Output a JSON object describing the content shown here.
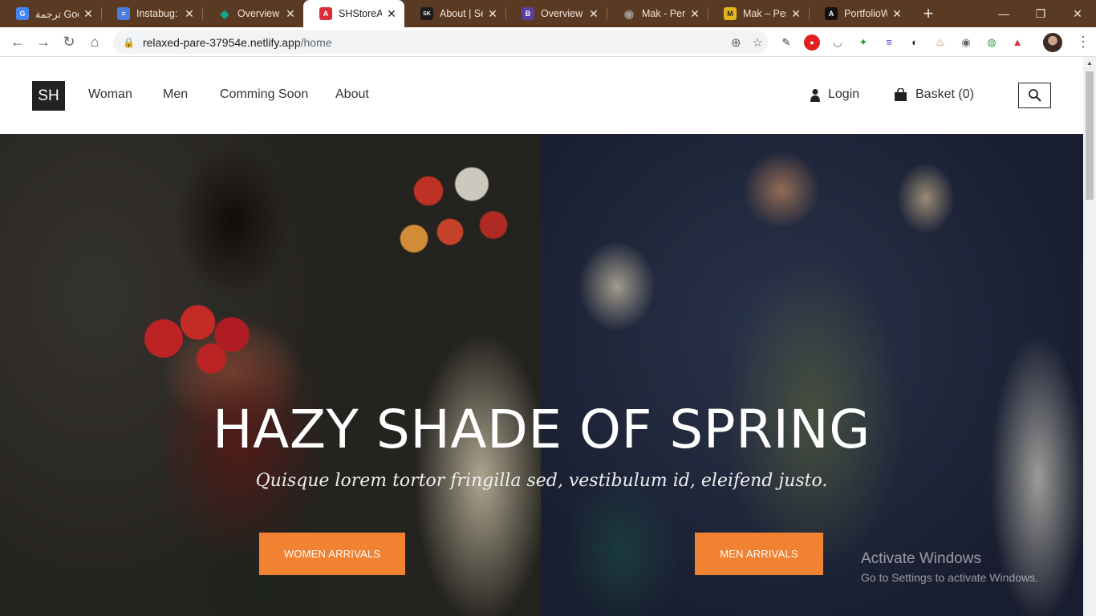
{
  "browser": {
    "tabs": [
      {
        "title": "ترجمة Google",
        "favicon_color": "#4285f4",
        "favicon_text": "G"
      },
      {
        "title": "Instabug: Fr",
        "favicon_color": "#4a7de0",
        "favicon_text": "≡"
      },
      {
        "title": "Overview | r",
        "favicon_color": "#12a38a",
        "favicon_text": "◆"
      },
      {
        "title": "SHStoreApp",
        "favicon_color": "#dd2c3c",
        "favicon_text": "A",
        "active": true
      },
      {
        "title": "About | Seb",
        "favicon_color": "#1b1b1b",
        "favicon_text": "SK"
      },
      {
        "title": "Overview · B",
        "favicon_color": "#5b3fa0",
        "favicon_text": "B"
      },
      {
        "title": "Mak - Perso",
        "favicon_color": "#6b6b6b",
        "favicon_text": "◉"
      },
      {
        "title": "Mak – Perso",
        "favicon_color": "#e6b41e",
        "favicon_text": "M"
      },
      {
        "title": "PortfolioWe",
        "favicon_color": "#111111",
        "favicon_text": "A"
      }
    ],
    "new_tab": "+",
    "window_controls": {
      "minimize": "—",
      "maximize": "❐",
      "close": "✕"
    },
    "address": {
      "host": "relaxed-pare-37954e.netlify.app",
      "path": "/home"
    },
    "nav": {
      "back": "←",
      "forward": "→",
      "reload": "↻",
      "home": "⌂"
    }
  },
  "site": {
    "logo": "SH",
    "nav_left": [
      "Woman",
      "Men",
      "Comming Soon",
      "About"
    ],
    "login": "Login",
    "basket": "Basket (0)",
    "hero": {
      "title": "HAZY SHADE OF SPRING",
      "subtitle": "Quisque lorem tortor fringilla sed, vestibulum id, eleifend justo.",
      "cta_women": "WOMEN ARRIVALS",
      "cta_men": "MEN ARRIVALS"
    },
    "accent_color": "#f08232"
  },
  "os_watermark": {
    "title": "Activate Windows",
    "subtitle": "Go to Settings to activate Windows."
  }
}
